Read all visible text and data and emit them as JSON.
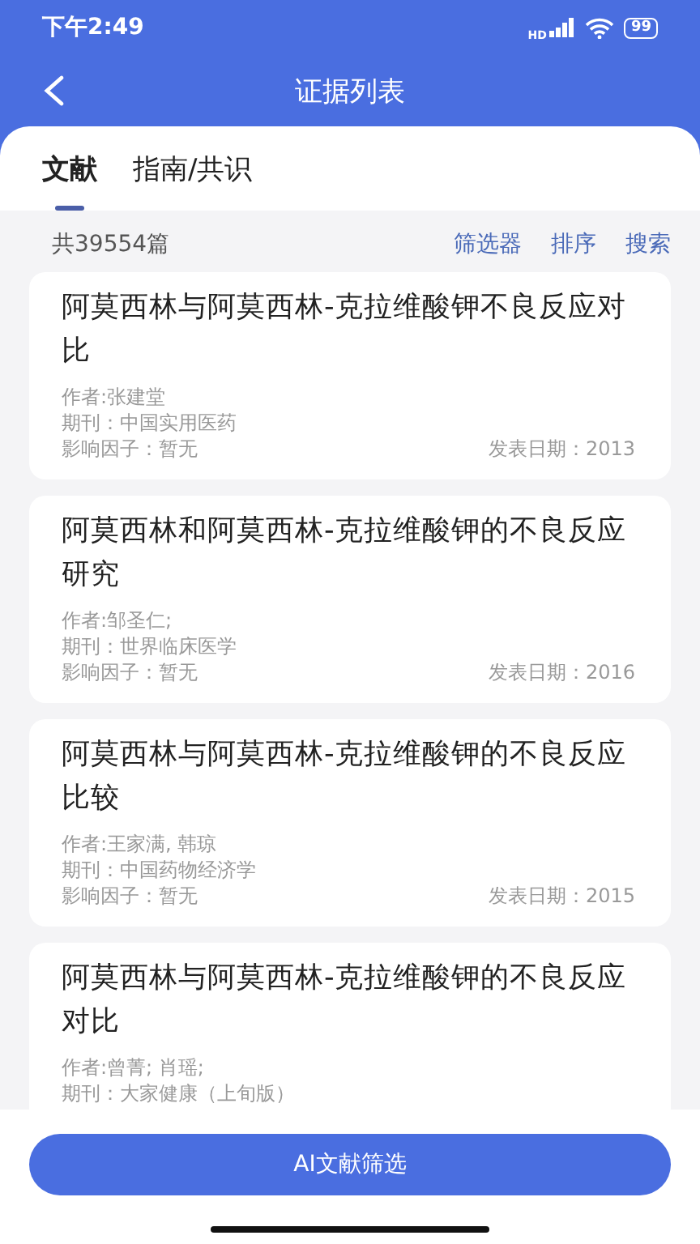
{
  "status_bar": {
    "time": "下午2:49",
    "network": "HD",
    "battery": "99"
  },
  "header": {
    "title": "证据列表"
  },
  "tabs": [
    {
      "label": "文献",
      "selected": true
    },
    {
      "label": "指南/共识",
      "selected": false
    }
  ],
  "toolbar": {
    "count": "共39554篇",
    "actions": [
      "筛选器",
      "排序",
      "搜索"
    ]
  },
  "articles": [
    {
      "title": "阿莫西林与阿莫西林-克拉维酸钾不良反应对比",
      "author": "作者:张建堂",
      "journal": "期刊：中国实用医药",
      "impact": "影响因子：暂无",
      "date": "发表日期：2013"
    },
    {
      "title": "阿莫西林和阿莫西林-克拉维酸钾的不良反应研究",
      "author": "作者:邹圣仁;",
      "journal": "期刊：世界临床医学",
      "impact": "影响因子：暂无",
      "date": "发表日期：2016"
    },
    {
      "title": "阿莫西林与阿莫西林-克拉维酸钾的不良反应比较",
      "author": "作者:王家满, 韩琼",
      "journal": "期刊：中国药物经济学",
      "impact": "影响因子：暂无",
      "date": "发表日期：2015"
    },
    {
      "title": "阿莫西林与阿莫西林-克拉维酸钾的不良反应对比",
      "author": "作者:曾菁; 肖瑶;",
      "journal": "期刊：大家健康（上旬版）"
    }
  ],
  "bottom_button": "AI文献筛选"
}
